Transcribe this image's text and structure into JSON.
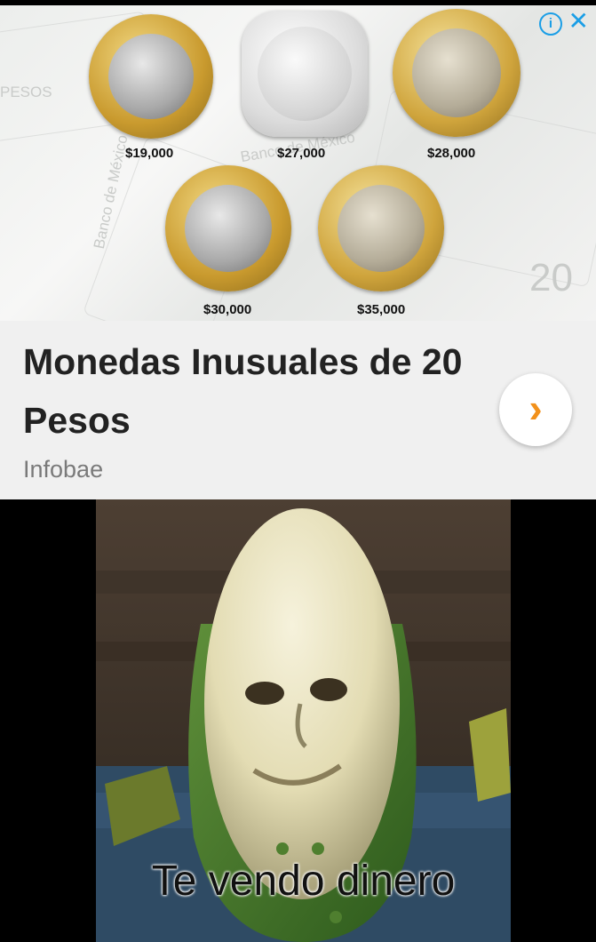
{
  "ad": {
    "info_icon": "info-icon",
    "close_icon": "close-icon",
    "coins": [
      {
        "price": "$19,000",
        "style": "bimetal"
      },
      {
        "price": "$27,000",
        "style": "silver"
      },
      {
        "price": "$28,000",
        "style": "gold"
      },
      {
        "price": "$30,000",
        "style": "bimetal"
      },
      {
        "price": "$35,000",
        "style": "gold"
      }
    ],
    "background_text": [
      "Banco de México",
      "Banco de México",
      "PESOS",
      "20"
    ],
    "headline": "Monedas Inusuales de 20 Pesos",
    "source": "Infobae",
    "next_icon": "chevron-right-icon",
    "accent_color": "#f2911b",
    "info_color": "#1a9ee6"
  },
  "meme": {
    "caption": "Te vendo dinero"
  }
}
